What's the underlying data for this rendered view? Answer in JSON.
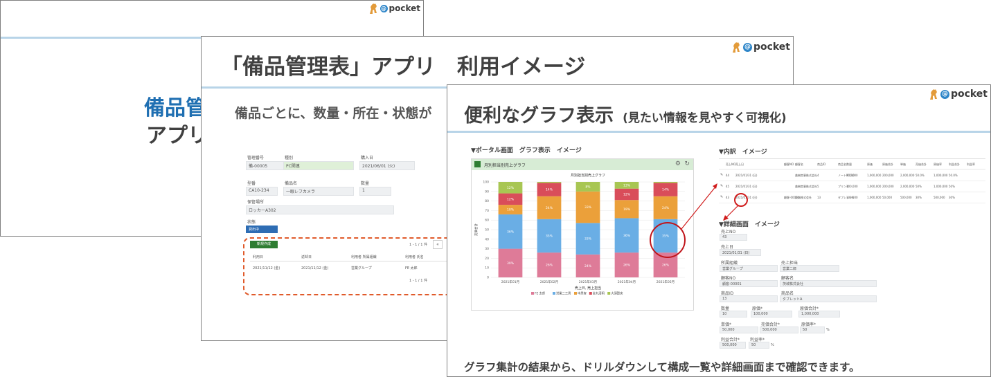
{
  "slide1": {
    "title_line1": "備品管",
    "title_line2": "アプリ",
    "logo_text": "pocket"
  },
  "slide2": {
    "title": "「備品管理表」アプリ　利用イメージ",
    "subtitle": "備品ごとに、数量・所在・状態が",
    "logo_text": "pocket",
    "form": {
      "mgmt_no_label": "管理番号",
      "mgmt_no": "備-00005",
      "type_label": "種別",
      "type": "PC関連",
      "purchase_label": "購入日",
      "purchase": "2021/06/01 (火)",
      "model_label": "型番",
      "model": "CA10-234",
      "item_label": "備品名",
      "item": "一眼レフカメラ",
      "qty_label": "数量",
      "qty": "1",
      "location_label": "保管場所",
      "location": "ロッカーA302",
      "status_label": "状態",
      "status": "貸出中"
    },
    "table": {
      "new_button": "新規作成",
      "pager_top": "1 - 1 / 1 件",
      "pager_bottom": "1 - 1 / 1 件",
      "headers": [
        "利用日",
        "返却日",
        "利用者 所属組織",
        "利用者 氏名"
      ],
      "row": [
        "2021/11/12 (金)",
        "2021/11/12 (金)",
        "営業グループ",
        "FE 太郎"
      ]
    }
  },
  "slide3": {
    "title": "便利なグラフ表示",
    "title_sub": "(見たい情報を見やすく可視化)",
    "logo_text": "pocket",
    "portal_label": "▼ポータル画面　グラフ表示　イメージ",
    "breakdown_label": "▼内訳　イメージ",
    "detail_label": "▼詳細画面　イメージ",
    "footer": "グラフ集計の結果から、ドリルダウンして構成一覧や詳細画面まで確認できます。",
    "breakdown": {
      "headers": [
        "売上NO",
        "売上日",
        "",
        "顧客NO",
        "顧客名",
        "商品ID",
        "商品名",
        "数量",
        "原価",
        "原価合計",
        "単価",
        "売価合計",
        "原価率",
        "利益合計",
        "利益率"
      ],
      "rows": [
        [
          "44",
          "2021/01/31 (日)",
          "",
          "",
          "美樹商事株式会社",
          "4",
          "ノートPC(10",
          "100,000",
          "1,000,000",
          "200,000",
          "2,000,000",
          "50.0%",
          "1,000,000",
          "50.0%"
        ],
        [
          "45",
          "2021/01/31 (日)",
          "",
          "",
          "美樹商事株式会社",
          "5",
          "プリンタ",
          "100,000",
          "1,000,000",
          "200,000",
          "2,000,000",
          "50%",
          "1,000,000",
          "50%"
        ],
        [
          "43",
          "2021/01/31 (日)",
          "",
          "顧客-00001",
          "茨城株式会社",
          "13",
          "タブレットA",
          "100,000",
          "1,000,000",
          "50,000",
          "500,000",
          "30%",
          "500,000",
          "30%"
        ]
      ]
    },
    "detail": {
      "no_label": "売上NO",
      "no": "43",
      "date_label": "売上日",
      "date": "2021/01/31 (日)",
      "org_label": "所属組織",
      "org": "営業グループ",
      "person_label": "売上担当",
      "person": "営業二郎",
      "cust_no_label": "顧客NO",
      "cust_no": "顧客-00001",
      "cust_name_label": "顧客名",
      "cust_name": "茨城株式会社",
      "prod_id_label": "商品ID",
      "prod_id": "13",
      "prod_name_label": "商品名",
      "prod_name": "タブレットA",
      "qty_label": "数量",
      "qty": "10",
      "cost_label": "原価*",
      "cost": "100,000",
      "cost_total_label": "原価合計*",
      "cost_total": "1,000,000",
      "price_label": "単価*",
      "price": "50,000",
      "sales_total_label": "売価合計*",
      "sales_total": "500,000",
      "cost_rate_label": "原価率*",
      "cost_rate": "50",
      "cost_rate_unit": "%",
      "profit_label": "利益合計*",
      "profit": "500,000",
      "profit_rate_label": "利益率*",
      "profit_rate": "50",
      "profit_rate_unit": "%"
    }
  },
  "colors": {
    "accent": "#2e86c9",
    "rule": "#b8d4e8",
    "dashed": "#e05a2a",
    "callout": "#d01c1c",
    "green": "#2e7d32"
  },
  "chart_data": {
    "type": "bar",
    "stacked": true,
    "panel_title": "月別担当別売上グラフ",
    "title": "月別担当別売上グラフ",
    "xlabel": "売上日, 売上担当",
    "ylabel": "売価合計",
    "ylim": [
      0,
      100
    ],
    "yticks": [
      0,
      10,
      20,
      30,
      40,
      50,
      60,
      70,
      80,
      90,
      100
    ],
    "categories": [
      "2021年01月",
      "2021年02月",
      "2021年03月",
      "2021年04月",
      "2021年05月"
    ],
    "series": [
      {
        "name": "FE 太郎",
        "color": "#de7b98",
        "values": [
          30,
          26,
          24,
          26,
          26
        ]
      },
      {
        "name": "営業二三男",
        "color": "#6aaee5",
        "values": [
          36,
          35,
          33,
          36,
          35
        ]
      },
      {
        "name": "中黒智",
        "color": "#eba03a",
        "values": [
          10,
          24,
          33,
          19,
          24
        ]
      },
      {
        "name": "金丸清明",
        "color": "#d94d5a",
        "values": [
          12,
          14,
          0,
          12,
          14
        ]
      },
      {
        "name": "大須賀実",
        "color": "#a8c653",
        "values": [
          12,
          1,
          10,
          7,
          1
        ]
      }
    ],
    "data_labels": [
      [
        "30%",
        "36%",
        "10%",
        "12%",
        "12%"
      ],
      [
        "26%",
        "35%",
        "24%",
        "14%",
        ""
      ],
      [
        "24%",
        "33%",
        "33%",
        "",
        "8%"
      ],
      [
        "26%",
        "36%",
        "19%",
        "12%",
        "13%"
      ],
      [
        "26%",
        "35%",
        "24%",
        "14%",
        ""
      ]
    ],
    "legend_position": "bottom",
    "grid": true
  }
}
